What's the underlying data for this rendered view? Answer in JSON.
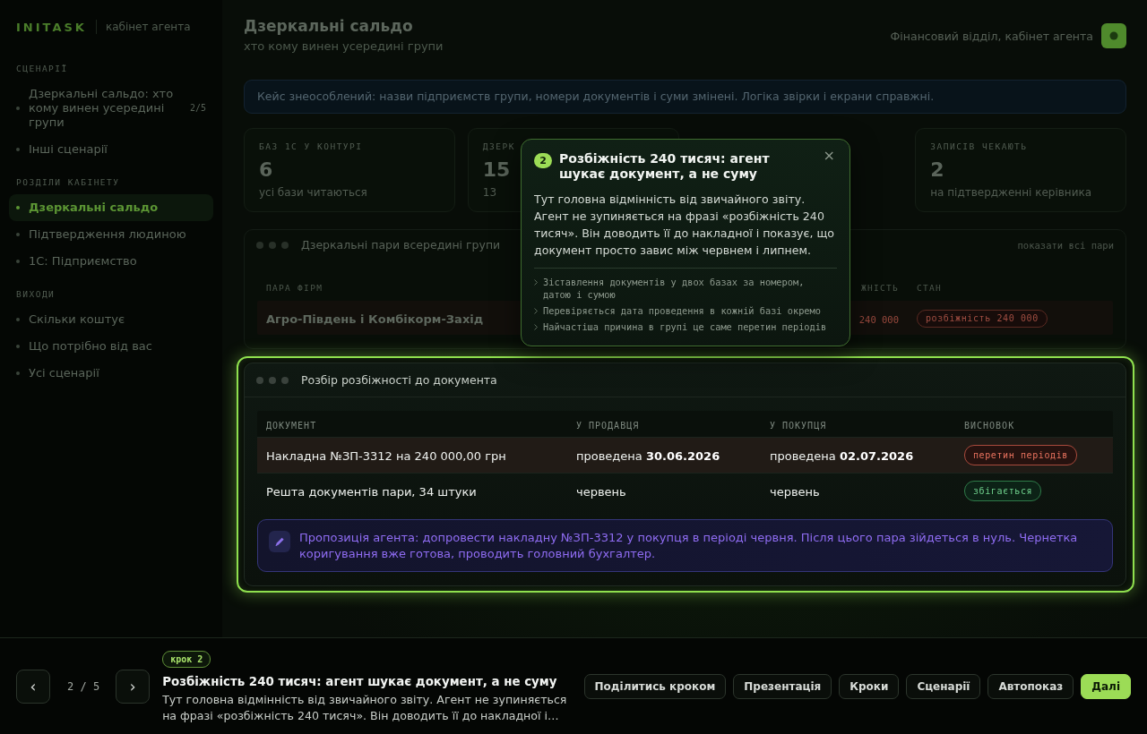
{
  "sidebar": {
    "logo": "INITASK",
    "subtitle": "кабінет агента",
    "sections": [
      {
        "title": "СЦЕНАРІЇ",
        "items": [
          {
            "label": "Дзеркальні сальдо: хто кому винен усередині групи",
            "count": "2/5",
            "selected": false
          },
          {
            "label": "Інші сценарії",
            "selected": false
          }
        ]
      },
      {
        "title": "РОЗДІЛИ КАБІНЕТУ",
        "items": [
          {
            "label": "Дзеркальні сальдо",
            "selected": true
          },
          {
            "label": "Підтвердження людиною",
            "selected": false
          },
          {
            "label": "1С: Підприємство",
            "selected": false
          }
        ]
      },
      {
        "title": "ВИХОДИ",
        "items": [
          {
            "label": "Скільки коштує",
            "selected": false
          },
          {
            "label": "Що потрібно від вас",
            "selected": false
          },
          {
            "label": "Усі сценарії",
            "selected": false
          }
        ]
      }
    ]
  },
  "header": {
    "title": "Дзеркальні сальдо",
    "subtitle": "хто кому винен усередині групи",
    "account": "Фінансовий відділ, кабінет агента"
  },
  "banner": "Кейс знеособлений: назви підприємств групи, номери документів і суми змінені. Логіка звірки і екрани справжні.",
  "stat_cards": [
    {
      "label": "БАЗ 1С У КОНТУРІ",
      "value": "6",
      "note": "усі бази читаються"
    },
    {
      "label": "ДЗЕРК",
      "value": "15",
      "note": "13"
    },
    {
      "label": "ЗАПИСІВ ЧЕКАЮТЬ",
      "value": "2",
      "note": "на підтвердженні керівника"
    }
  ],
  "pairs_panel": {
    "title": "Дзеркальні пари всередині групи",
    "action": "показати всі пари",
    "columns": [
      "ПАРА ФІРМ",
      "ЖНІСТЬ",
      "СТАН"
    ],
    "rows": [
      {
        "pair": "Агро-Південь і Комбікорм-Захід",
        "amount": "240 000",
        "status": {
          "label": "розбіжність 240 000",
          "kind": "danger"
        }
      }
    ]
  },
  "doc_panel": {
    "title": "Розбір розбіжності до документа",
    "highlighted": true,
    "columns": [
      "ДОКУМЕНТ",
      "У ПРОДАВЦЯ",
      "У ПОКУПЦЯ",
      "ВИСНОВОК"
    ],
    "rows": [
      {
        "selected": true,
        "cells": [
          "Накладна №ЗП-3312 на 240 000,00 грн",
          "проведена **30.06.2026**",
          "проведена **02.07.2026**"
        ],
        "status": {
          "label": "перетин періодів",
          "kind": "danger"
        }
      },
      {
        "selected": false,
        "cells": [
          "Решта документів пари, 34 штуки",
          "червень",
          "червень"
        ],
        "status": {
          "label": "збігається",
          "kind": "ok"
        }
      }
    ],
    "note": "Пропозиція агента: допровести накладну №ЗП-3312 у покупця в періоді червня. Після цього пара зійдеться в нуль. Чернетка коригування вже готова, проводить головний бухгалтер."
  },
  "popover": {
    "step": "2",
    "title": "Розбіжність 240 тисяч: агент шукає документ, а не суму",
    "close": "×",
    "body": "Тут головна відмінність від звичайного звіту. Агент не зупиняється на фразі «розбіжність 240 тисяч». Він доводить її до накладної і показує, що документ просто завис між червнем і липнем.",
    "bullets": [
      "Зіставлення документів у двох базах за номером, датою і сумою",
      "Перевіряється дата проведення в кожній базі окремо",
      "Найчастіша причина в групі це саме перетин періодів"
    ]
  },
  "step_bar": {
    "prev": "‹",
    "position": "2 / 5",
    "next": "›",
    "badge": "крок 2",
    "title": "Розбіжність 240 тисяч: агент шукає документ, а не суму",
    "text": "Тут головна відмінність від звичайного звіту. Агент не зупиняється на фразі «розбіжність 240 тисяч». Він доводить її до накладної і…",
    "buttons": [
      {
        "label": "Поділитись кроком",
        "primary": false
      },
      {
        "label": "Презентація",
        "primary": false
      },
      {
        "label": "Кроки",
        "primary": false
      },
      {
        "label": "Сценарії",
        "primary": false
      },
      {
        "label": "Автопоказ",
        "primary": false
      },
      {
        "label": "Далі",
        "primary": true
      }
    ]
  }
}
